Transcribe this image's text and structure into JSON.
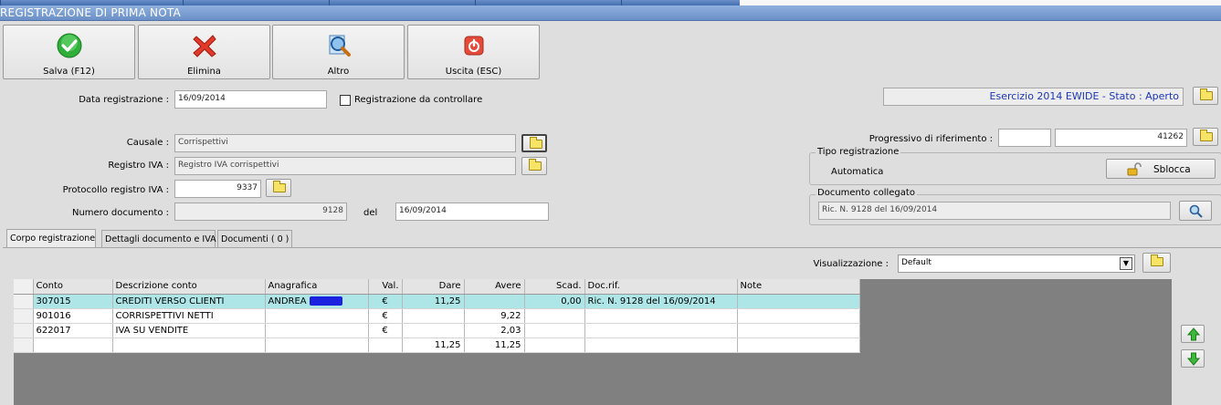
{
  "window": {
    "title": "REGISTRAZIONE DI PRIMA NOTA"
  },
  "toolbar": {
    "save_label": "Salva (F12)",
    "delete_label": "Elimina",
    "other_label": "Altro",
    "exit_label": "Uscita (ESC)"
  },
  "form": {
    "data_registrazione_label": "Data registrazione :",
    "data_registrazione": "16/09/2014",
    "da_controllare_label": "Registrazione da controllare",
    "causale_label": "Causale :",
    "causale": "Corrispettivi",
    "registro_iva_label": "Registro IVA :",
    "registro_iva": "Registro IVA corrispettivi",
    "protocollo_label": "Protocollo registro IVA :",
    "protocollo": "9337",
    "numero_documento_label": "Numero documento :",
    "numero_documento": "9128",
    "del_label": "del",
    "del_date": "16/09/2014"
  },
  "right_panel": {
    "esercizio": "Esercizio 2014 EWIDE - Stato : Aperto",
    "progressivo_label": "Progressivo di riferimento :",
    "progressivo_a": "",
    "progressivo_b": "41262",
    "tipo_group": "Tipo registrazione",
    "tipo_value": "Automatica",
    "sblocca_label": "Sblocca",
    "doc_group": "Documento collegato",
    "doc_value": "Ric. N. 9128 del 16/09/2014"
  },
  "tabs": [
    {
      "label": "Corpo registrazione"
    },
    {
      "label": "Dettagli documento e IVA"
    },
    {
      "label": "Documenti ( 0 )"
    }
  ],
  "visualizzazione": {
    "label": "Visualizzazione :",
    "value": "Default"
  },
  "grid": {
    "columns": [
      "Conto",
      "Descrizione conto",
      "Anagrafica",
      "Val.",
      "Dare",
      "Avere",
      "Scad.",
      "Doc.rif.",
      "Note"
    ],
    "rows": [
      {
        "conto": "307015",
        "descrizione": "CREDITI VERSO CLIENTI",
        "anagrafica": "ANDREA",
        "val": "€",
        "dare": "11,25",
        "avere": "",
        "scad": "0,00",
        "docrif": "Ric. N. 9128 del 16/09/2014",
        "note": ""
      },
      {
        "conto": "901016",
        "descrizione": "CORRISPETTIVI NETTI",
        "anagrafica": "",
        "val": "€",
        "dare": "",
        "avere": "9,22",
        "scad": "",
        "docrif": "",
        "note": ""
      },
      {
        "conto": "622017",
        "descrizione": "IVA SU VENDITE",
        "anagrafica": "",
        "val": "€",
        "dare": "",
        "avere": "2,03",
        "scad": "",
        "docrif": "",
        "note": ""
      }
    ],
    "totals": {
      "dare": "11,25",
      "avere": "11,25"
    }
  }
}
